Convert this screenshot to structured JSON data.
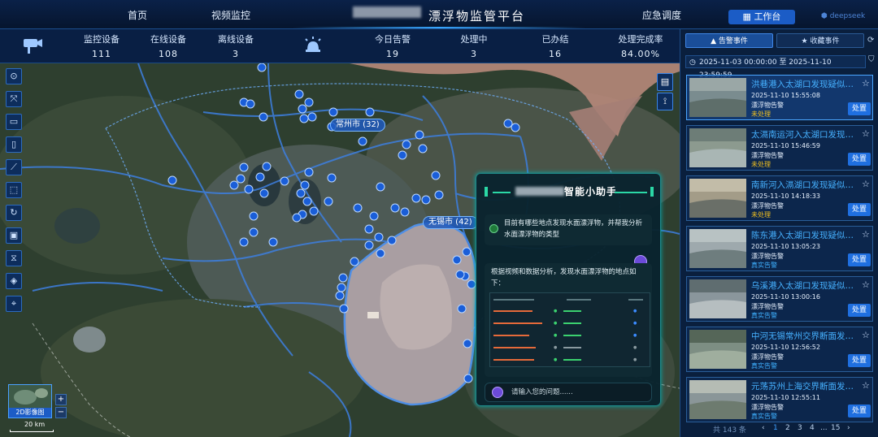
{
  "nav": {
    "left": [
      "首页",
      "视频监控"
    ],
    "title": "漂浮物监管平台",
    "right_link": "应急调度",
    "workbench": "工作台",
    "brand": "deepseek"
  },
  "stats": [
    {
      "label": "监控设备",
      "value": "111"
    },
    {
      "label": "在线设备",
      "value": "108"
    },
    {
      "label": "离线设备",
      "value": "3"
    },
    {
      "label": "今日告警",
      "value": "19"
    },
    {
      "label": "处理中",
      "value": "3"
    },
    {
      "label": "已办结",
      "value": "16"
    },
    {
      "label": "处理完成率",
      "value": "84.00%"
    }
  ],
  "map": {
    "cities": [
      {
        "name": "常州市 (32)"
      },
      {
        "name": "无锡市 (42)"
      }
    ],
    "tools": [
      "locate-icon",
      "expand-icon",
      "camera-icon",
      "device-icon",
      "ruler-icon",
      "area-icon",
      "refresh-icon",
      "image-icon",
      "filter-icon",
      "layers-icon",
      "marker-icon"
    ],
    "basemap_label": "2D影像图",
    "scale_label": "20 km",
    "zoom_in": "+",
    "zoom_out": "−"
  },
  "assistant": {
    "title": "智能小助手",
    "user_msg": "目前有哪些地点发现水面漂浮物，并帮我分析水面漂浮物的类型",
    "bot_msg": "根据视频和数据分析，发现水面漂浮物的地点如下：",
    "input_placeholder": "请输入您的问题......"
  },
  "panel": {
    "tabs": [
      "告警事件",
      "收藏事件"
    ],
    "date_range": "2025-11-03 00:00:00  至  2025-11-10 23:59:59",
    "events": [
      {
        "title": "洪巷港入太湖口发现疑似漂浮物",
        "time": "2025-11-10 15:55:08",
        "type": "漂浮物告警",
        "status": "未处理",
        "status_color": "#f0c020",
        "action": "处置"
      },
      {
        "title": "太滆南运河入太湖口发现疑似漂浮物",
        "time": "2025-11-10 15:46:59",
        "type": "漂浮物告警",
        "status": "未处理",
        "status_color": "#f0c020",
        "action": "处置"
      },
      {
        "title": "南新河入滆湖口发现疑似漂浮物",
        "time": "2025-11-10 14:18:33",
        "type": "漂浮物告警",
        "status": "未处理",
        "status_color": "#f0c020",
        "action": "处置"
      },
      {
        "title": "陈东港入太湖口发现疑似漂浮物",
        "time": "2025-11-10 13:05:23",
        "type": "漂浮物告警",
        "status": "真实告警",
        "status_color": "#3fb0ff",
        "action": "处置"
      },
      {
        "title": "乌溪港入太湖口发现疑似漂浮物",
        "time": "2025-11-10 13:00:16",
        "type": "漂浮物告警",
        "status": "真实告警",
        "status_color": "#3fb0ff",
        "action": "处置"
      },
      {
        "title": "中河无锡常州交界断面发现疑似漂浮物",
        "time": "2025-11-10 12:56:52",
        "type": "漂浮物告警",
        "status": "真实告警",
        "status_color": "#3fb0ff",
        "action": "处置"
      },
      {
        "title": "元荡苏州上海交界断面发现疑似漂浮物",
        "time": "2025-11-10 12:55:11",
        "type": "漂浮物告警",
        "status": "真实告警",
        "status_color": "#3fb0ff",
        "action": "处置"
      }
    ],
    "pager": {
      "total": "共 143 条",
      "pages": [
        "1",
        "2",
        "3",
        "4",
        "...",
        "15"
      ],
      "prev": "‹",
      "next": "›"
    }
  }
}
